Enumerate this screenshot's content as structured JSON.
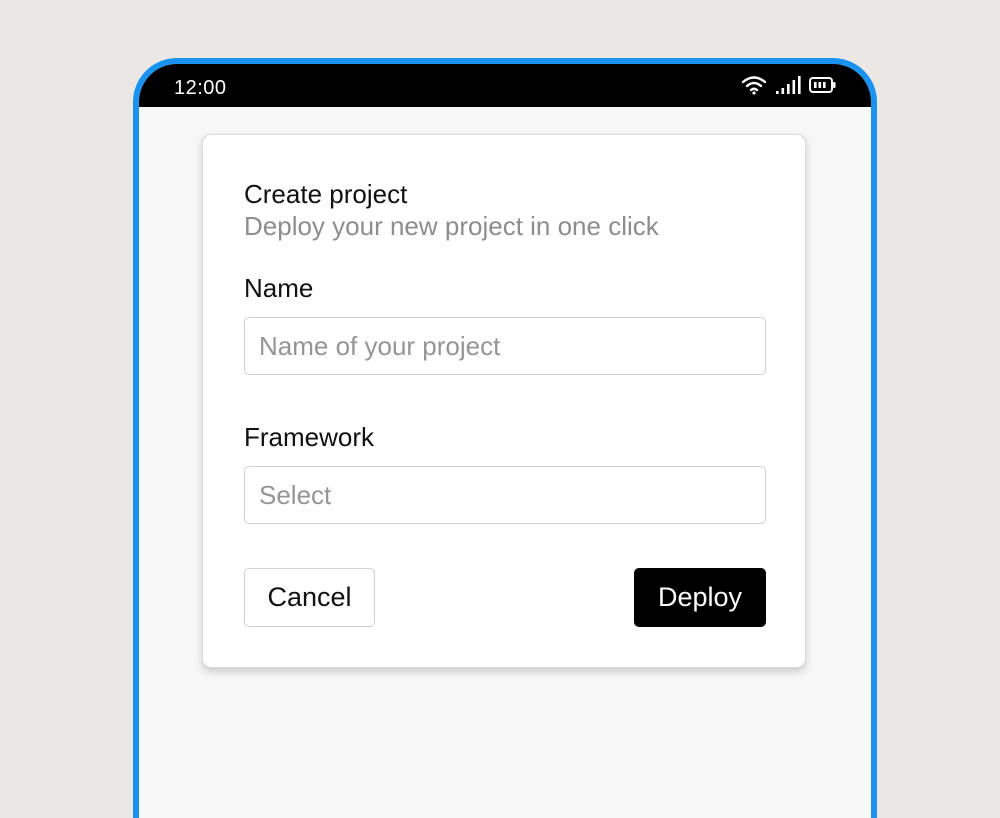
{
  "status_bar": {
    "time": "12:00",
    "icons": [
      "wifi-icon",
      "cellular-signal-icon",
      "battery-icon"
    ]
  },
  "dialog": {
    "title": "Create project",
    "subtitle": "Deploy your new project in one click",
    "fields": {
      "name": {
        "label": "Name",
        "value": "",
        "placeholder": "Name of your project"
      },
      "framework": {
        "label": "Framework",
        "selected": "Select"
      }
    },
    "buttons": {
      "cancel": "Cancel",
      "deploy": "Deploy"
    }
  },
  "colors": {
    "phone_frame": "#1a93f0",
    "primary_button": "#000000",
    "page_background": "#ebe7e4"
  }
}
